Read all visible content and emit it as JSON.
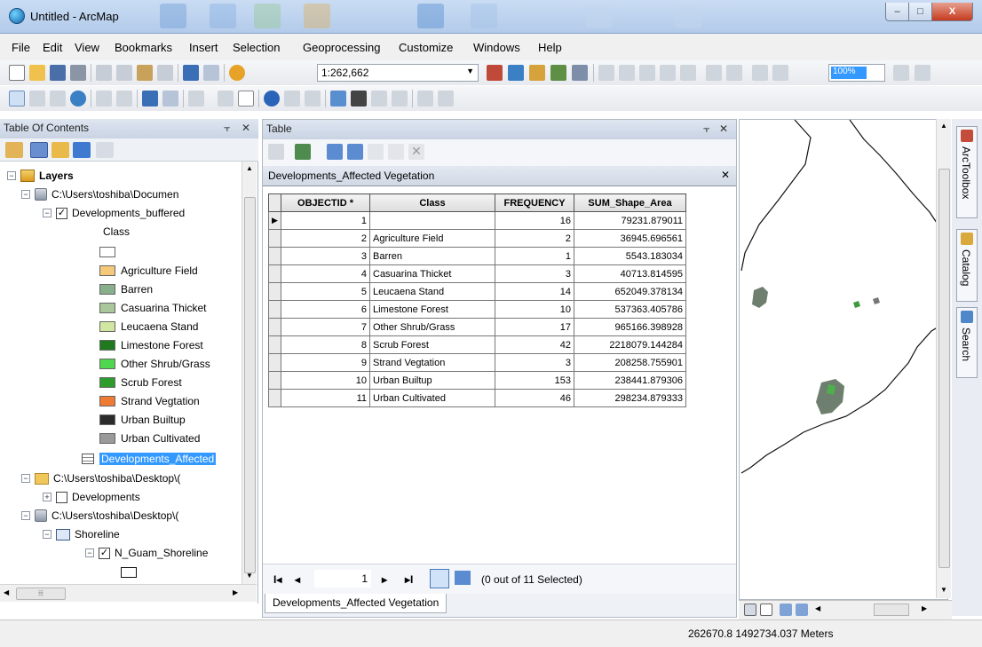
{
  "window": {
    "title": "Untitled - ArcMap",
    "minimize_glyph": "–",
    "maximize_glyph": "□",
    "close_glyph": "X"
  },
  "menu": [
    "File",
    "Edit",
    "View",
    "Bookmarks",
    "Insert",
    "Selection",
    "Geoprocessing",
    "Customize",
    "Windows",
    "Help"
  ],
  "toolbar": {
    "scale": "1:262,662",
    "zoom_percent": "100%"
  },
  "toc": {
    "title": "Table Of Contents",
    "pin": "⫟",
    "close": "✕",
    "layers_label": "Layers",
    "db1_path": "C:\\Users\\toshiba\\Documen",
    "layer1_name": "Developments_buffered",
    "field_label": "Class",
    "legend": [
      {
        "label": "Agriculture Field",
        "color": "#f5c87a"
      },
      {
        "label": "Barren",
        "color": "#88b08c"
      },
      {
        "label": "Casuarina Thicket",
        "color": "#a9c79a"
      },
      {
        "label": "Leucaena Stand",
        "color": "#d1e6a0"
      },
      {
        "label": "Limestone Forest",
        "color": "#1f7a1f"
      },
      {
        "label": "Other Shrub/Grass",
        "color": "#4fd84f"
      },
      {
        "label": "Scrub Forest",
        "color": "#2d9c2d"
      },
      {
        "label": "Strand Vegtation",
        "color": "#ee7a33"
      },
      {
        "label": "Urban Builtup",
        "color": "#2b2b2b"
      },
      {
        "label": "Urban Cultivated",
        "color": "#9a9a9a"
      }
    ],
    "table_item": "Developments_Affected",
    "folder_path": "C:\\Users\\toshiba\\Desktop\\(",
    "developments_label": "Developments",
    "db2_path": "C:\\Users\\toshiba\\Desktop\\(",
    "shoreline_group": "Shoreline",
    "shoreline_layer": "N_Guam_Shoreline"
  },
  "table_window": {
    "title": "Table",
    "pin": "⫟",
    "close": "✕",
    "layer_tab": "Developments_Affected Vegetation",
    "layer_close": "✕",
    "columns": [
      "OBJECTID *",
      "Class",
      "FREQUENCY",
      "SUM_Shape_Area"
    ],
    "rows": [
      {
        "objectid": "1",
        "class": "",
        "frequency": "16",
        "area": "79231.879011"
      },
      {
        "objectid": "2",
        "class": "Agriculture Field",
        "frequency": "2",
        "area": "36945.696561"
      },
      {
        "objectid": "3",
        "class": "Barren",
        "frequency": "1",
        "area": "5543.183034"
      },
      {
        "objectid": "4",
        "class": "Casuarina Thicket",
        "frequency": "3",
        "area": "40713.814595"
      },
      {
        "objectid": "5",
        "class": "Leucaena Stand",
        "frequency": "14",
        "area": "652049.378134"
      },
      {
        "objectid": "6",
        "class": "Limestone Forest",
        "frequency": "10",
        "area": "537363.405786"
      },
      {
        "objectid": "7",
        "class": "Other Shrub/Grass",
        "frequency": "17",
        "area": "965166.398928"
      },
      {
        "objectid": "8",
        "class": "Scrub Forest",
        "frequency": "42",
        "area": "2218079.144284"
      },
      {
        "objectid": "9",
        "class": "Strand Vegtation",
        "frequency": "3",
        "area": "208258.755901"
      },
      {
        "objectid": "10",
        "class": "Urban Builtup",
        "frequency": "153",
        "area": "238441.879306"
      },
      {
        "objectid": "11",
        "class": "Urban Cultivated",
        "frequency": "46",
        "area": "298234.879333"
      }
    ],
    "nav": {
      "first": "I◂",
      "prev": "◂",
      "current": "1",
      "next": "▸",
      "last": "▸I",
      "selection_status": "(0 out of 11 Selected)"
    },
    "bottom_tab": "Developments_Affected Vegetation"
  },
  "dock": {
    "arctoolbox": "ArcToolbox",
    "catalog": "Catalog",
    "search": "Search"
  },
  "status": {
    "coordinates": "262670.8  1492734.037 Meters"
  }
}
